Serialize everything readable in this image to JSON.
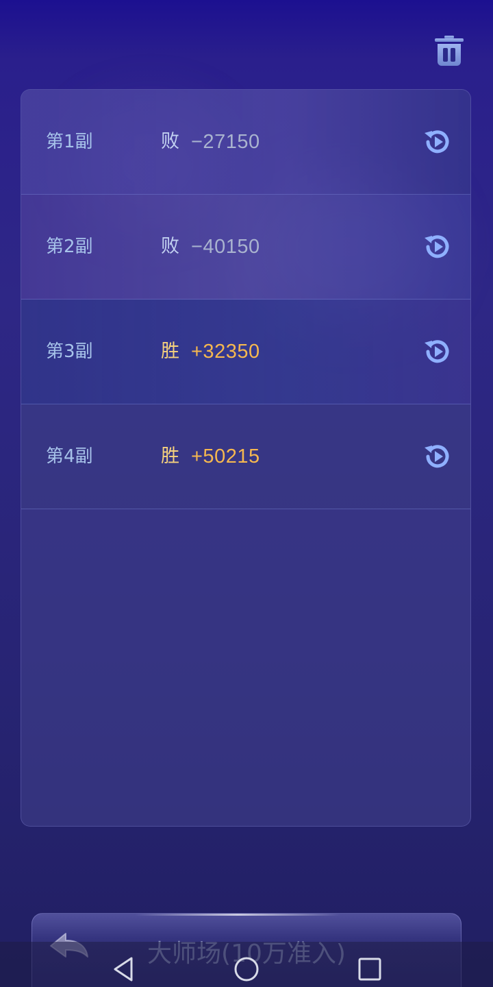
{
  "header": {
    "delete_icon": "trash-icon"
  },
  "records": [
    {
      "label": "第1副",
      "result": "败",
      "score": "−27150",
      "outcome": "lose",
      "icon": "replay-icon"
    },
    {
      "label": "第2副",
      "result": "败",
      "score": "−40150",
      "outcome": "lose",
      "icon": "replay-icon"
    },
    {
      "label": "第3副",
      "result": "胜",
      "score": "+32350",
      "outcome": "win",
      "icon": "replay-icon"
    },
    {
      "label": "第4副",
      "result": "胜",
      "score": "+50215",
      "outcome": "win",
      "icon": "replay-icon"
    }
  ],
  "footer": {
    "room_title": "大师场(10万准入)",
    "back_icon": "back-arrow-icon"
  },
  "system_nav": {
    "back": "triangle-back-icon",
    "home": "circle-home-icon",
    "recents": "square-recents-icon"
  },
  "colors": {
    "win": "#f6b84f",
    "lose": "#a9b3cf",
    "label": "#a7c3ea",
    "icon": "#8fb0ff"
  }
}
